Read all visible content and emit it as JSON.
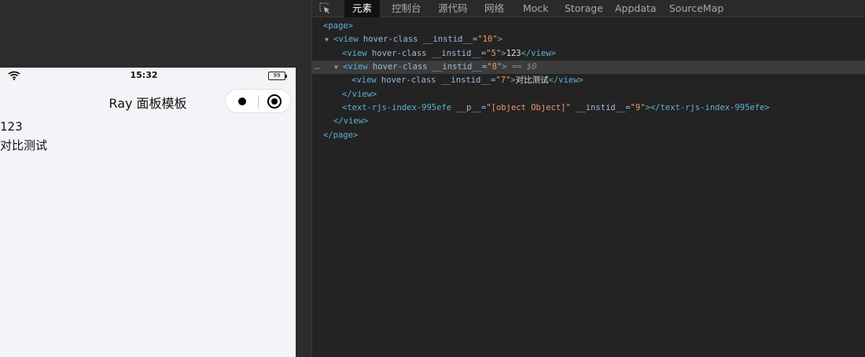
{
  "simulator": {
    "status_time": "15:32",
    "battery_level": "99",
    "nav_title": "Ray 面板模板",
    "content_lines": [
      "123",
      "对比测试"
    ]
  },
  "devtools": {
    "tabs": [
      "元素",
      "控制台",
      "源代码",
      "网络",
      "Mock",
      "Storage",
      "Appdata",
      "SourceMap"
    ],
    "active_tab": "元素",
    "tree": {
      "l0_open": "<page>",
      "l1_tag_open": "<view",
      "l1_attr1": " hover-class",
      "l1_attr2": " __instid__=",
      "l1_val": "\"10\"",
      "l1_close": ">",
      "l2a_tag_open": "<view",
      "l2a_attr1": " hover-class",
      "l2a_attr2": " __instid__=",
      "l2a_val": "\"5\"",
      "l2a_gt": ">",
      "l2a_text": "123",
      "l2a_end": "</view>",
      "ellipsis": "…",
      "l2b_tag_open": "<view",
      "l2b_attr1": " hover-class",
      "l2b_attr2": " __instid__=",
      "l2b_val": "\"8\"",
      "l2b_gt": ">",
      "l2b_sel": " == $0",
      "l3_tag_open": "<view",
      "l3_attr1": " hover-class",
      "l3_attr2": " __instid__=",
      "l3_val": "\"7\"",
      "l3_gt": ">",
      "l3_text": "对比测试",
      "l3_end": "</view>",
      "l2b_end": "</view>",
      "l2c_tag_open": "<text-rjs-index-995efe",
      "l2c_attr1": " __p__=",
      "l2c_val1": "\"[object Object]\"",
      "l2c_attr2": " __instid__=",
      "l2c_val2": "\"9\"",
      "l2c_gt": ">",
      "l2c_end": "</text-rjs-index-995efe>",
      "l1_end": "</view>",
      "l0_end": "</page>"
    }
  },
  "colors": {
    "tag": "#5db0d7",
    "attr": "#9bbbdc",
    "value": "#f29766",
    "panel_bg": "#232323",
    "simulator_bg": "#f3f4f7"
  },
  "icons": [
    "wifi-icon",
    "battery-icon",
    "capsule-menu-icon",
    "capsule-close-icon",
    "inspect-element-icon",
    "expand-triangle-icon"
  ]
}
